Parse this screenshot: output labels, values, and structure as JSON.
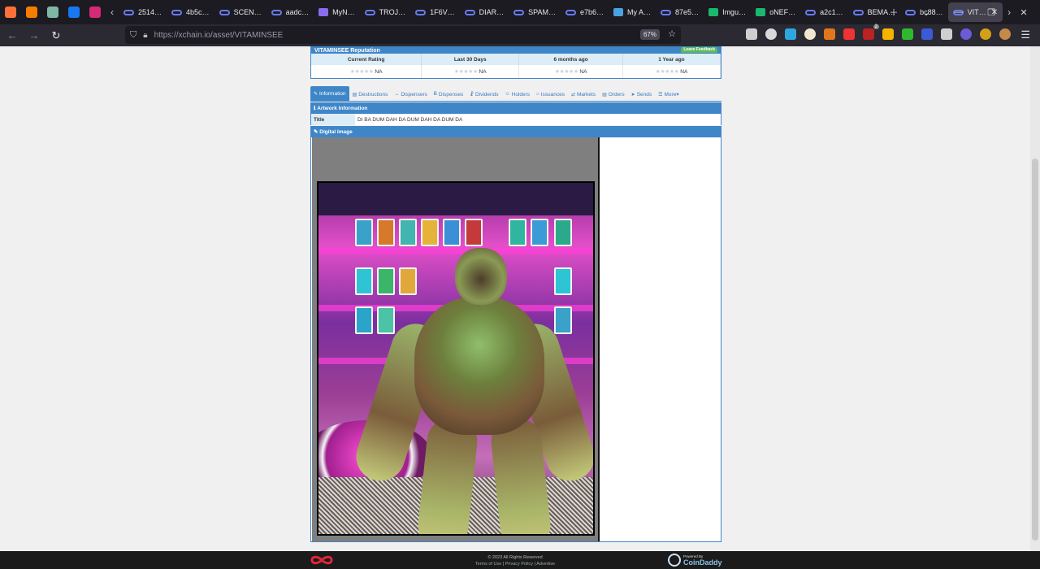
{
  "browser": {
    "tabs": [
      {
        "label": "",
        "icon": "firefox-icon",
        "color": "#ff7139"
      },
      {
        "label": "",
        "icon": "blogger-icon",
        "color": "#f57d00"
      },
      {
        "label": "",
        "icon": "app-icon",
        "color": "#7fb8a4"
      },
      {
        "label": "",
        "icon": "facebook-icon",
        "color": "#1877f2"
      },
      {
        "label": "",
        "icon": "instagram-icon",
        "color": "#d62976"
      },
      {
        "label": "2514…",
        "icon": "link-icon"
      },
      {
        "label": "4b5c…",
        "icon": "link-icon"
      },
      {
        "label": "SCEN…",
        "icon": "link-icon"
      },
      {
        "label": "aadc…",
        "icon": "link-icon"
      },
      {
        "label": "MyN…",
        "icon": "app-icon",
        "color": "#8a6cf0"
      },
      {
        "label": "TROJ…",
        "icon": "link-icon"
      },
      {
        "label": "1F6V…",
        "icon": "link-icon"
      },
      {
        "label": "DIAR…",
        "icon": "link-icon"
      },
      {
        "label": "SPAM…",
        "icon": "link-icon"
      },
      {
        "label": "e7b6…",
        "icon": "link-icon"
      },
      {
        "label": "My A…",
        "icon": "app-icon",
        "color": "#4aa3df"
      },
      {
        "label": "87e5…",
        "icon": "link-icon"
      },
      {
        "label": "Imgu…",
        "icon": "imgur-icon",
        "color": "#1bb76e"
      },
      {
        "label": "oNEF…",
        "icon": "imgur-icon",
        "color": "#1bb76e"
      },
      {
        "label": "a2c1…",
        "icon": "link-icon"
      },
      {
        "label": "BEMA…",
        "icon": "link-icon"
      },
      {
        "label": "bc88…",
        "icon": "link-icon"
      },
      {
        "label": "VIT…",
        "icon": "link-icon",
        "active": true
      }
    ],
    "url": "https://xchain.io/asset/VITAMINSEE",
    "zoom": "67%",
    "extension_badge": "2"
  },
  "reputation": {
    "title": "VITAMINSEE Reputation",
    "feedback_label": "Leave Feedback",
    "columns": [
      "Current Rating",
      "Last 30 Days",
      "6 months ago",
      "1 Year ago"
    ],
    "values": [
      "NA",
      "NA",
      "NA",
      "NA"
    ],
    "stars": "★★★★★"
  },
  "tabs": [
    {
      "label": "Information",
      "icon": "✎",
      "active": true
    },
    {
      "label": "Destructions",
      "icon": "▤"
    },
    {
      "label": "Dispensers",
      "icon": "↔"
    },
    {
      "label": "Dispenses",
      "icon": "Ƀ"
    },
    {
      "label": "Dividends",
      "icon": "☧"
    },
    {
      "label": "Holders",
      "icon": "☺"
    },
    {
      "label": "Issuances",
      "icon": "⌂"
    },
    {
      "label": "Markets",
      "icon": "⇄"
    },
    {
      "label": "Orders",
      "icon": "▤"
    },
    {
      "label": "Sends",
      "icon": "➤"
    },
    {
      "label": "More",
      "icon": "☰",
      "suffix": " ▾"
    }
  ],
  "artwork": {
    "section_title": "Artwork Information",
    "title_label": "Title",
    "title_value": "DI BA DUM DAH DA DUM DAH DA DUM DA",
    "image_section_title": "Digital Image"
  },
  "footer": {
    "copyright": "© 2023 All Rights Reserved",
    "links": [
      "Terms of Use",
      "Privacy Policy",
      "Advertise"
    ],
    "powered_by": "Powered By",
    "brand": "CoinDaddy"
  },
  "colors": {
    "accent": "#3f86c8",
    "header_bg": "#ddedf8",
    "feedback": "#5cb85c",
    "footer_bg": "#1b1b1b",
    "brand_red": "#e0263a"
  }
}
